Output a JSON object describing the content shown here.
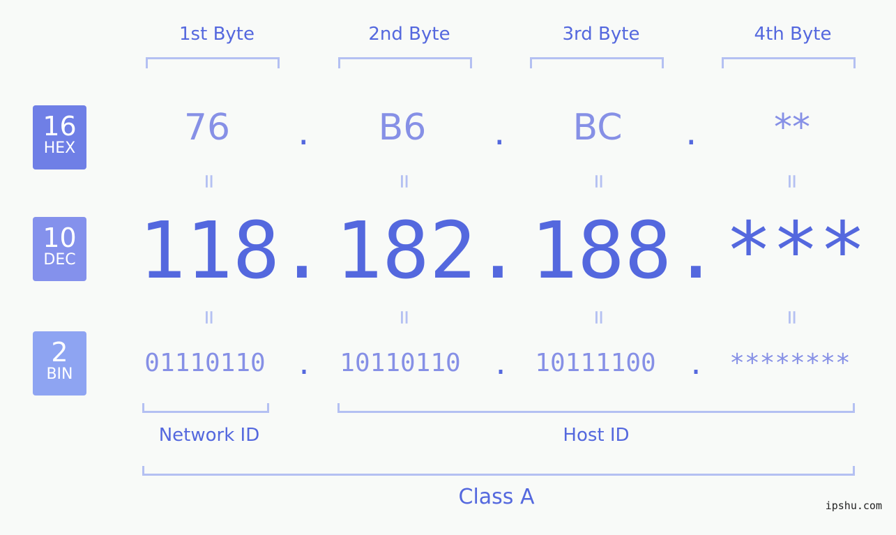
{
  "headers": [
    "1st Byte",
    "2nd Byte",
    "3rd Byte",
    "4th Byte"
  ],
  "badges": [
    {
      "num": "16",
      "label": "HEX",
      "color": "#6f7fe6"
    },
    {
      "num": "10",
      "label": "DEC",
      "color": "#8491ec"
    },
    {
      "num": "2",
      "label": "BIN",
      "color": "#8ea4f2"
    }
  ],
  "hex": [
    "76",
    "B6",
    "BC",
    "**"
  ],
  "dec": [
    "118",
    "182",
    "188",
    "***"
  ],
  "bin": [
    "01110110",
    "10110110",
    "10111100",
    "********"
  ],
  "separator": ".",
  "equals": "=",
  "sections": {
    "network": "Network ID",
    "host": "Host ID",
    "class": "Class A"
  },
  "watermark": "ipshu.com"
}
